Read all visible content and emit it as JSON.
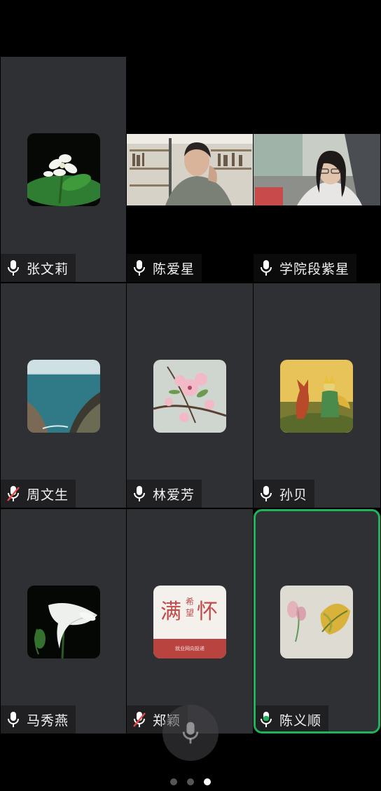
{
  "participants": [
    {
      "name": "张文莉",
      "mic": "on",
      "type": "avatar",
      "avatar": "white-flower"
    },
    {
      "name": "陈爱星",
      "mic": "on",
      "type": "video",
      "video": "person-bookshelf"
    },
    {
      "name": "学院段紫星",
      "mic": "on",
      "type": "video",
      "video": "person-glasses"
    },
    {
      "name": "周文生",
      "mic": "muted",
      "type": "avatar",
      "avatar": "sea-cliff"
    },
    {
      "name": "林爱芳",
      "mic": "on",
      "type": "avatar",
      "avatar": "peach-blossom"
    },
    {
      "name": "孙贝",
      "mic": "on",
      "type": "avatar",
      "avatar": "little-prince-fox"
    },
    {
      "name": "马秀燕",
      "mic": "on",
      "type": "avatar",
      "avatar": "morning-glory"
    },
    {
      "name": "郑颖",
      "mic": "muted",
      "type": "avatar",
      "avatar": "text-card"
    },
    {
      "name": "陈义顺",
      "mic": "speaking",
      "type": "avatar",
      "avatar": "leaf-watercolor"
    }
  ],
  "text_card": {
    "big_left": "满",
    "big_right": "怀",
    "small_top": "希",
    "small_bottom": "望",
    "footer": "就业网向投递"
  },
  "pager": {
    "pages": 3,
    "current": 3
  },
  "colors": {
    "active_border": "#1fb35b",
    "tile_bg": "#2f3033",
    "mic_speaking": "#1fb35b"
  }
}
